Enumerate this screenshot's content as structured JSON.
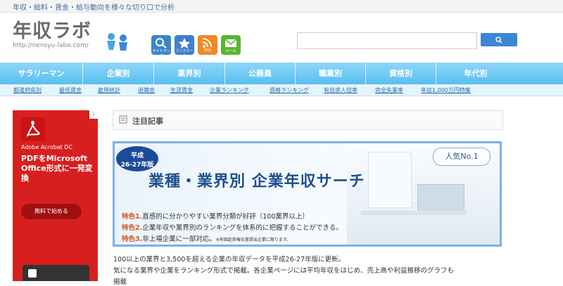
{
  "top_bar": {
    "tagline": "年収・給料・賃金・給与動向を様々な切り口で分析"
  },
  "logo": {
    "title": "年収ラボ",
    "url": "http://nensyu-labo.com/"
  },
  "header_icons": [
    {
      "label": "サイトマップ",
      "color": "#3c86c8"
    },
    {
      "label": "ブックマーク",
      "color": "#3f7fcc"
    },
    {
      "label": "RSS",
      "color": "#f08a24"
    },
    {
      "label": "メール",
      "color": "#5ab533"
    }
  ],
  "search": {
    "placeholder": ""
  },
  "nav": [
    "サラリーマン",
    "企業別",
    "業界別",
    "公務員",
    "職業別",
    "資格別",
    "年代別"
  ],
  "subnav": [
    "都道府県別",
    "最低賃金",
    "雇用統計",
    "退職金",
    "生涯賃金",
    "企業ランキング",
    "資格ランキング",
    "有効求人倍率",
    "完全失業率",
    "年収1,000万円特集"
  ],
  "ad": {
    "brand": "Adobe Acrobat DC",
    "headline": "PDFをMicrosoft Office形式に一発変換",
    "cta": "無料で始める",
    "info": "i"
  },
  "section": {
    "title": "注目記事"
  },
  "banner": {
    "badge_line1": "平成",
    "badge_line2": "26-27年版",
    "popular": "人気No.1",
    "title": "業種・業界別 企業年収サーチ",
    "features": [
      {
        "label": "特色1.",
        "text": "直感的に分かりやすい業界分類が好評（100業界以上）",
        "note": ""
      },
      {
        "label": "特色2.",
        "text": "企業年収や業界別のランキングを体系的に把握することができる。",
        "note": ""
      },
      {
        "label": "特色3.",
        "text": "非上場企業に一部対応。",
        "note": "※有価証券報告書提出企業に限ります。"
      }
    ]
  },
  "description": {
    "line1": "100以上の業界と3,500を超える企業の年収データを平成26-27年版に更新。",
    "line2": "気になる業界や企業をランキング形式で掲載。各企業ページには平均年収をはじめ、売上高や利益推移のグラフも",
    "line3": "掲載"
  },
  "colors": {
    "nav": "#58bfee",
    "accent": "#1e4f8f",
    "ad": "#d81f1f"
  }
}
